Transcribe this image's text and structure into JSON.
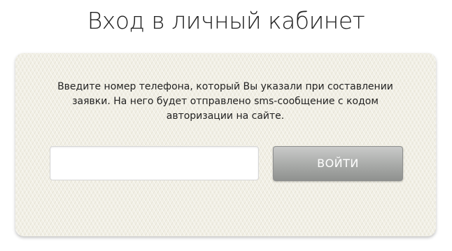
{
  "page": {
    "title": "Вход в личный кабинет"
  },
  "login_card": {
    "instructions": "Введите номер телефона, который Вы указали при составлении заявки. На него будет отправлено sms-сообщение с кодом авторизации на сайте.",
    "phone_input": {
      "value": "",
      "placeholder": ""
    },
    "submit_label": "ВОЙТИ"
  },
  "colors": {
    "card_background": "#f1efe5",
    "button_gradient_top": "#c9cac9",
    "button_gradient_bottom": "#8f918f",
    "button_text": "#ffffff",
    "title_text": "#222222"
  }
}
